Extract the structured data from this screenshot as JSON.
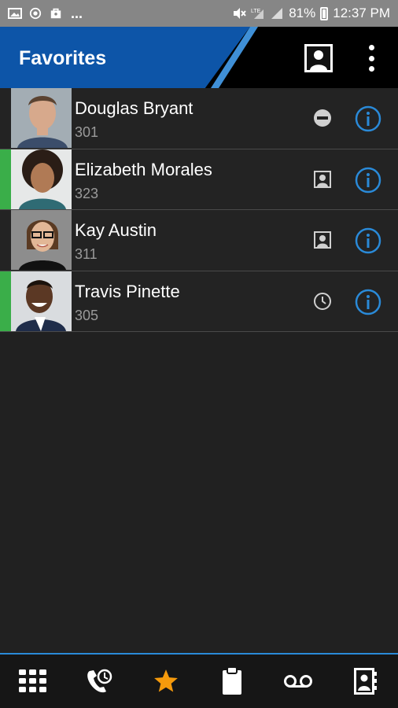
{
  "status_bar": {
    "icons_left": [
      "image-icon",
      "vpn-icon",
      "shopping-bag-icon"
    ],
    "overflow": "...",
    "icons_right": [
      "mute-icon",
      "lte-signal-icon",
      "signal-icon"
    ],
    "battery": "81%",
    "time": "12:37 PM"
  },
  "header": {
    "title": "Favorites",
    "colors": {
      "blue": "#0d55a8",
      "stripe": "#3f8fd6"
    }
  },
  "favorites": [
    {
      "name": "Douglas Bryant",
      "ext": "301",
      "presence": "none",
      "status_icon": "do-not-disturb-icon"
    },
    {
      "name": "Elizabeth Morales",
      "ext": "323",
      "presence": "online",
      "status_icon": "contact-card-icon"
    },
    {
      "name": "Kay Austin",
      "ext": "311",
      "presence": "none",
      "status_icon": "contact-card-icon"
    },
    {
      "name": "Travis Pinette",
      "ext": "305",
      "presence": "online",
      "status_icon": "clock-icon"
    }
  ],
  "colors": {
    "online": "#3aae49",
    "accent": "#2a8ad8",
    "star": "#f59a0c"
  },
  "bottom_nav": [
    "dialpad-icon",
    "call-activity-icon",
    "favorites-star-icon",
    "clipboard-icon",
    "voicemail-icon",
    "contacts-book-icon"
  ]
}
